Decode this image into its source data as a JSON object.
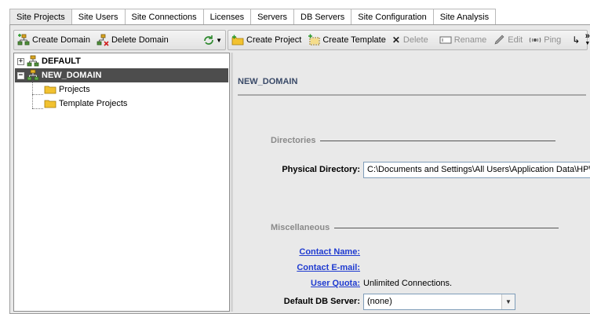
{
  "tabs": [
    {
      "label": "Site Projects",
      "active": true
    },
    {
      "label": "Site Users"
    },
    {
      "label": "Site Connections"
    },
    {
      "label": "Licenses"
    },
    {
      "label": "Servers"
    },
    {
      "label": "DB Servers"
    },
    {
      "label": "Site Configuration"
    },
    {
      "label": "Site Analysis"
    }
  ],
  "left_toolbar": {
    "create_domain": "Create Domain",
    "delete_domain": "Delete Domain"
  },
  "right_toolbar": {
    "create_project": "Create Project",
    "create_template": "Create Template",
    "delete": "Delete",
    "rename": "Rename",
    "edit": "Edit",
    "ping": "Ping",
    "more": "»"
  },
  "tree": {
    "default_domain": "DEFAULT",
    "new_domain": "NEW_DOMAIN",
    "projects": "Projects",
    "template_projects": "Template Projects"
  },
  "details": {
    "title": "NEW_DOMAIN",
    "directories_header": "Directories",
    "physical_directory_label": "Physical Directory:",
    "physical_directory_value": "C:\\Documents and Settings\\All Users\\Application Data\\HP\\ALM\\",
    "misc_header": "Miscellaneous",
    "contact_name_label": "Contact Name:",
    "contact_email_label": "Contact E-mail:",
    "user_quota_label": "User Quota:",
    "user_quota_value": "Unlimited Connections.",
    "default_db_label": "Default DB Server:",
    "default_db_value": "(none)"
  },
  "colors": {
    "selection": "#4d4d4d",
    "link": "#1f3bd0",
    "title": "#3a4a68"
  }
}
